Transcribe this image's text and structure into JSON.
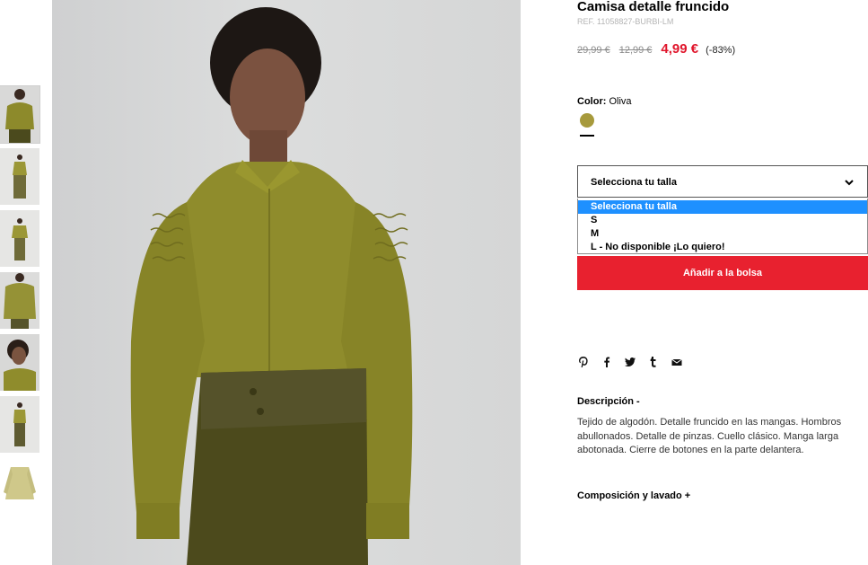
{
  "product": {
    "title": "Camisa detalle fruncido",
    "ref": "REF. 11058827-BURBI-LM",
    "price_original": "29,99 €",
    "price_previous": "12,99 €",
    "price_current": "4,99 €",
    "discount": "(-83%)"
  },
  "color": {
    "label": "Color:",
    "value": "Oliva",
    "swatch_color": "#a79a3c"
  },
  "size": {
    "select_label": "Selecciona tu talla",
    "options": [
      "Selecciona tu talla",
      "S",
      "M",
      "L - No disponible ¡Lo quiero!"
    ],
    "highlight_color": "#1e90ff"
  },
  "add_to_bag": {
    "label": "Añadir a la bolsa",
    "color": "#e8212f"
  },
  "share_icons": [
    "pinterest-icon",
    "facebook-icon",
    "twitter-icon",
    "tumblr-icon",
    "email-icon"
  ],
  "description": {
    "title": "Descripción -",
    "body": "Tejido de algodón. Detalle fruncido en las mangas. Hombros abullonados. Detalle de pinzas. Cuello clásico. Manga larga abotonada. Cierre de botones en la parte delantera."
  },
  "composition": {
    "title": "Composición y lavado +"
  },
  "gallery": {
    "thumbnail_count": 7,
    "active_index": 0,
    "shirt_color": "#8f8c2c",
    "trouser_color": "#4c4a1c"
  }
}
